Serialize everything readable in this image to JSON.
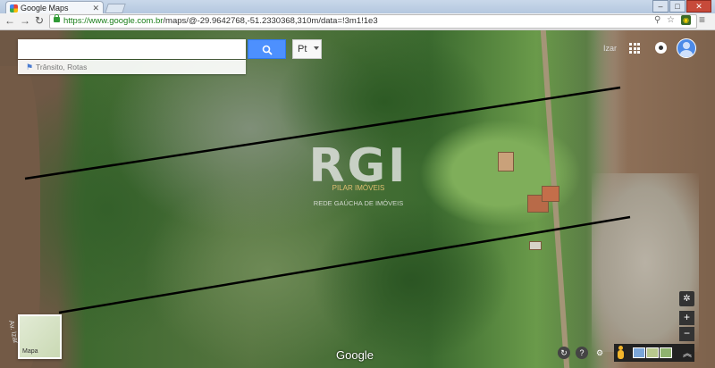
{
  "browser": {
    "tab_title": "Google Maps",
    "url_secure_part": "https://www.google.com.br",
    "url_rest": "/maps/@-29.9642768,-51.2330368,310m/data=!3m1!1e3",
    "zoom_icon": "magnifier-icon",
    "star_icon": "star-icon",
    "menu_icon": "hamburger-icon"
  },
  "search": {
    "placeholder": "",
    "button_icon": "search-icon",
    "lang_value": "Pt",
    "traffic_label": "Trânsito, Rotas"
  },
  "account": {
    "user_label": "Izar"
  },
  "watermark": {
    "logo": "RGI",
    "sub": "PILAR IMÓVEIS",
    "tagline": "REDE GAÚCHA DE IMÓVEIS"
  },
  "map": {
    "thumbnail_label": "Mapa",
    "google_logo": "Google",
    "zoom_in": "+",
    "zoom_out": "−",
    "side_label": "Av. Izar"
  },
  "colors": {
    "accent": "#4d90fe",
    "boundary_line": "#000000"
  }
}
